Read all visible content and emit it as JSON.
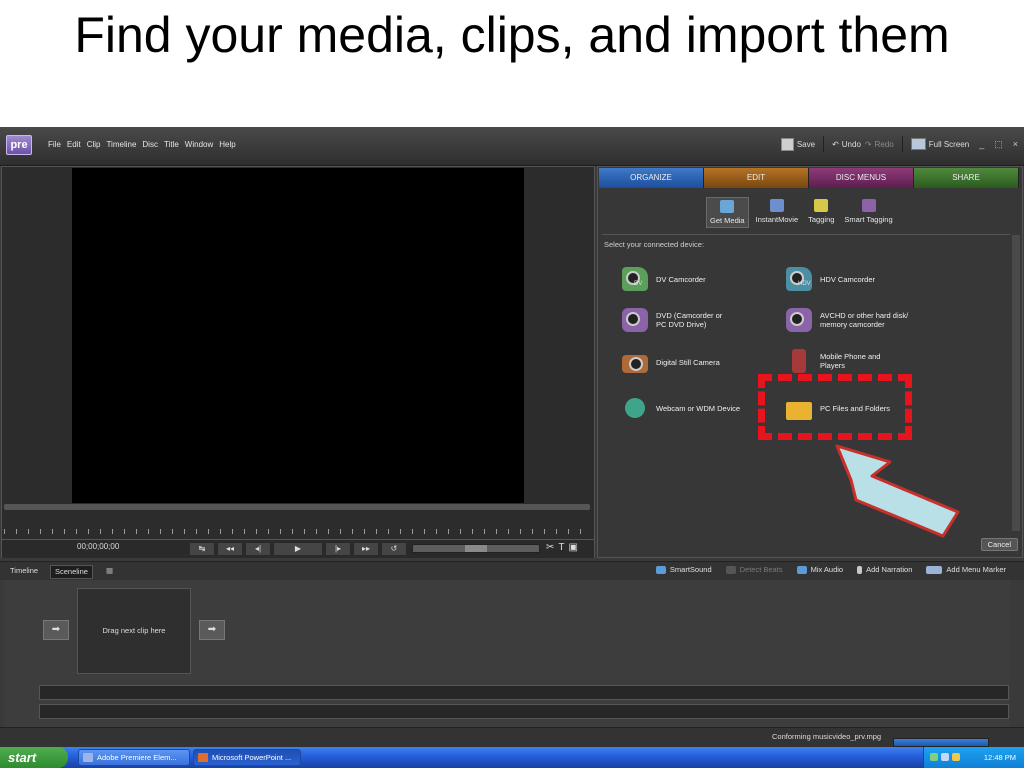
{
  "slide": {
    "title": "Find your media, clips, and import them"
  },
  "app": {
    "logo": "pre",
    "menu": [
      "File",
      "Edit",
      "Clip",
      "Timeline",
      "Disc",
      "Title",
      "Window",
      "Help"
    ],
    "toolbar": {
      "save": "Save",
      "undo": "Undo",
      "redo": "Redo",
      "fullscreen": "Full Screen"
    },
    "window_controls": [
      "_",
      "⬚",
      "×"
    ]
  },
  "monitor": {
    "timecode": "00;00;00;00",
    "controls": [
      "↹",
      "◂◂",
      "◂|",
      "▶",
      "|▸",
      "▸▸",
      "↺"
    ],
    "tools": [
      "✂",
      "T",
      "▣"
    ]
  },
  "panel": {
    "tabs": [
      "ORGANIZE",
      "EDIT",
      "DISC MENUS",
      "SHARE"
    ],
    "subtabs": [
      {
        "label": "Get Media",
        "icon": "get-media-icon"
      },
      {
        "label": "InstantMovie",
        "icon": "instant-movie-icon"
      },
      {
        "label": "Tagging",
        "icon": "tagging-icon"
      },
      {
        "label": "Smart Tagging",
        "icon": "smart-tagging-icon"
      }
    ],
    "prompt": "Select your connected device:",
    "devices": {
      "dv": "DV Camcorder",
      "hdv": "HDV Camcorder",
      "dvd_line1": "DVD (Camcorder or",
      "dvd_line2": "PC DVD Drive)",
      "avchd_line1": "AVCHD or other hard disk/",
      "avchd_line2": "memory camcorder",
      "still": "Digital Still Camera",
      "phone_line1": "Mobile Phone and",
      "phone_line2": "Players",
      "webcam": "Webcam or WDM Device",
      "pcfiles": "PC Files and Folders",
      "dv_mini": "DV",
      "hdv_mini": "HDV"
    },
    "cancel": "Cancel"
  },
  "timeline": {
    "tabs": [
      "Timeline",
      "Sceneline"
    ],
    "tools": [
      "SmartSound",
      "Detect Beats",
      "Mix Audio",
      "Add Narration",
      "Add Menu Marker"
    ],
    "placeholder": "Drag next clip here"
  },
  "status": {
    "text": "Conforming musicvideo_prv.mpg"
  },
  "taskbar": {
    "start": "start",
    "tasks": [
      "Adobe Premiere Elem...",
      "Microsoft PowerPoint ..."
    ],
    "clock": "12:48 PM"
  },
  "colors": {
    "highlight": "#e8141d",
    "arrow": "#b8e0e6"
  }
}
